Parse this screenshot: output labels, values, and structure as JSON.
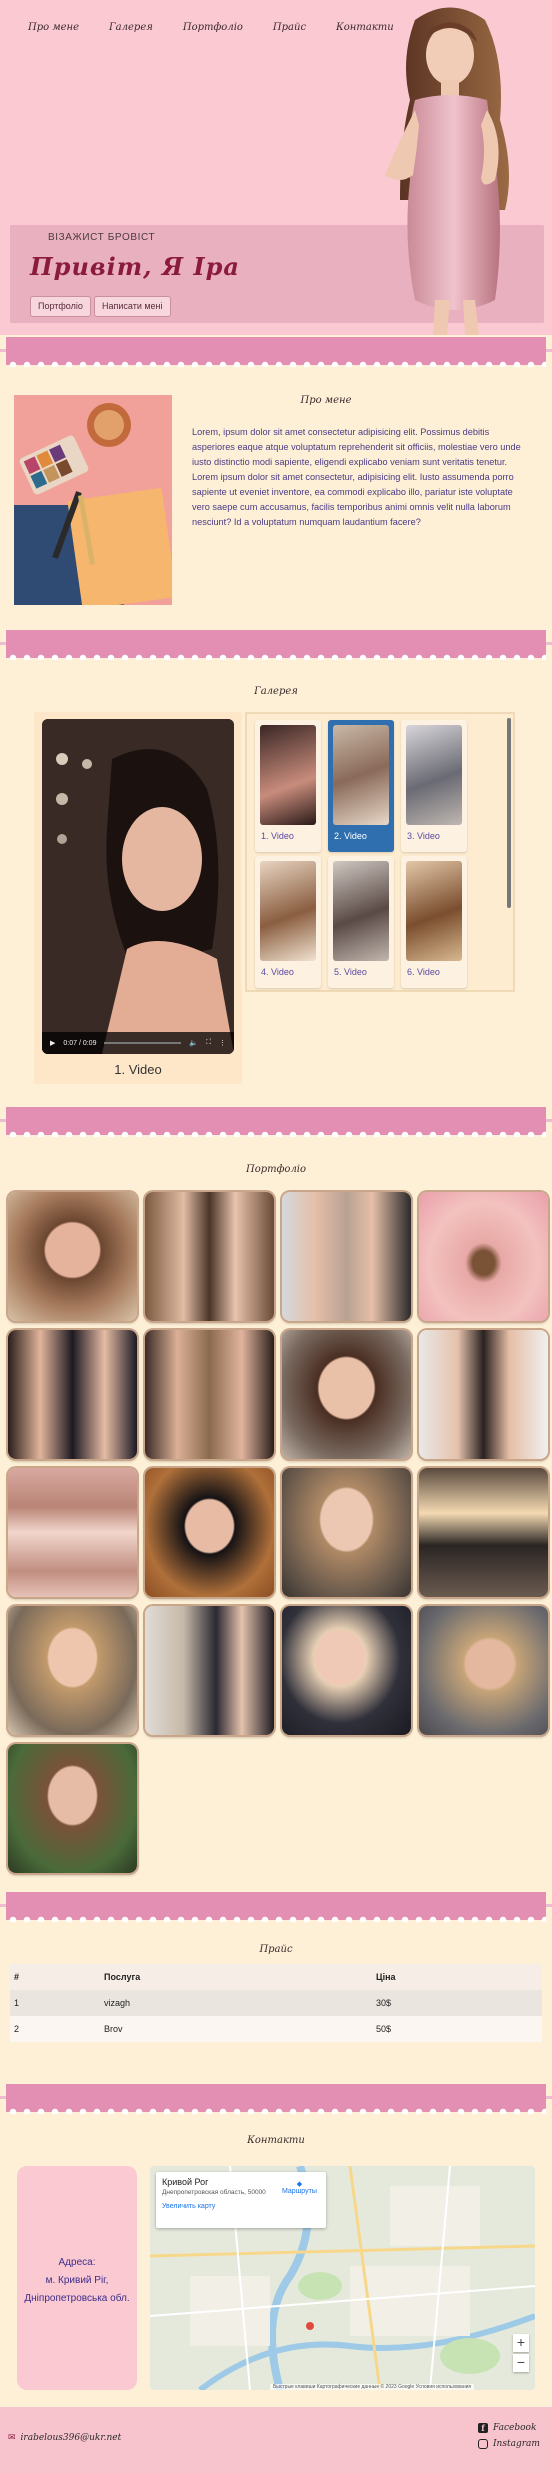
{
  "nav": {
    "about": "Про мене",
    "gallery": "Галерея",
    "portfolio": "Портфоліо",
    "price": "Прайс",
    "contacts": "Контакти"
  },
  "hero": {
    "subtitle": "ВІЗАЖИСТ БРОВІСТ",
    "title": "Привіт, Я Іра",
    "btn_portfolio": "Портфоліо",
    "btn_write": "Написати мені"
  },
  "about": {
    "title": "Про мене",
    "text": "Lorem, ipsum dolor sit amet consectetur adipisicing elit. Possimus debitis asperiores eaque atque voluptatum reprehenderit sit officiis, molestiae vero unde iusto distinctio modi sapiente, eligendi explicabo veniam sunt veritatis tenetur. Lorem ipsum dolor sit amet consectetur, adipisicing elit. Iusto assumenda porro sapiente ut eveniet inventore, ea commodi explicabo illo, pariatur iste voluptate vero saepe cum accusamus, facilis temporibus animi omnis velit nulla laborum nesciunt? Id a voluptatum numquam laudantium facere?"
  },
  "gallery": {
    "title": "Галерея",
    "main_caption": "1. Video",
    "video_time": "0:07 / 0:09",
    "thumbs": [
      "1. Video",
      "2. Video",
      "3. Video",
      "4. Video",
      "5. Video",
      "6. Video"
    ],
    "active_index": 2
  },
  "portfolio": {
    "title": "Портфоліо",
    "count": 17
  },
  "price": {
    "title": "Прайс",
    "headers": [
      "#",
      "Послуга",
      "Ціна"
    ],
    "rows": [
      [
        "1",
        "vizagh",
        "30$"
      ],
      [
        "2",
        "Brov",
        "50$"
      ]
    ]
  },
  "contacts": {
    "title": "Контакти",
    "address_label": "Адреса:",
    "address_city": "м. Кривий Ріг,",
    "address_region": "Дніпропетровська обл.",
    "map_city": "Кривой Рог",
    "map_region": "Днепропетровская область, 50000",
    "map_directions": "Маршруты",
    "map_enlarge": "Увеличить карту",
    "map_footer": "Быстрые клавиши   Картографические данные © 2023 Google   Условия использования"
  },
  "footer": {
    "email": "irabelous396@ukr.net",
    "facebook": "Facebook",
    "instagram": "Instagram"
  },
  "colors": {
    "hero_bg": "#fbc9d2",
    "accent": "#8a1b3f",
    "page_bg": "#fdf0d6",
    "active_thumb": "#2f6fb0",
    "link": "#4b3a86"
  }
}
